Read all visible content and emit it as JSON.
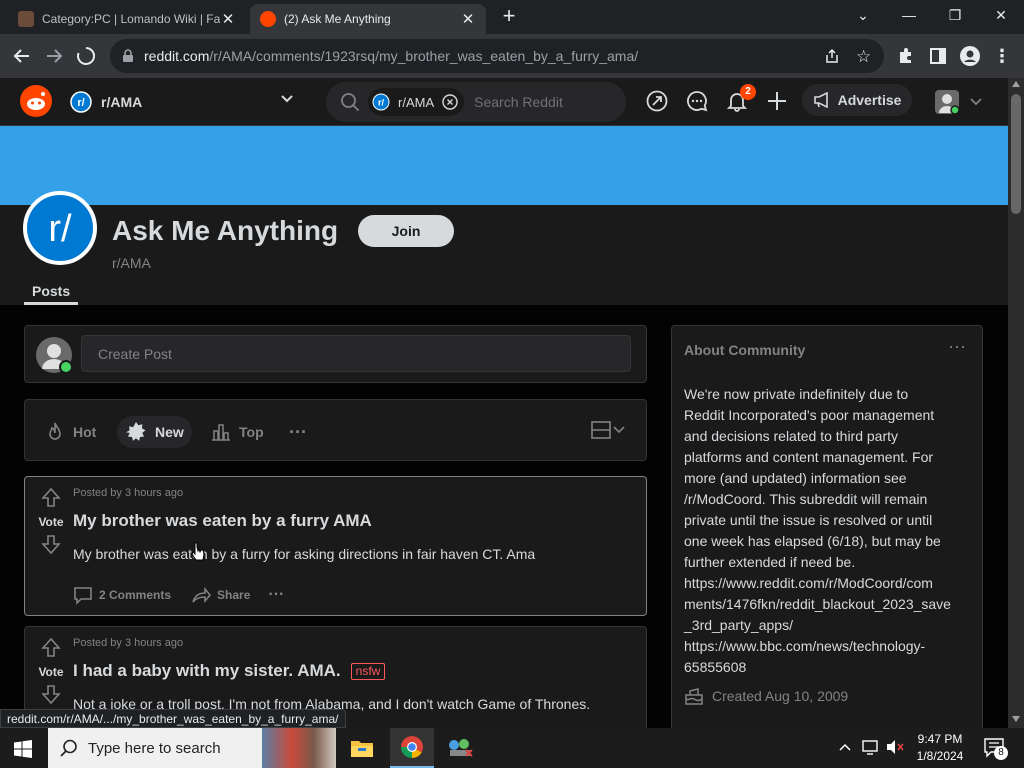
{
  "browser": {
    "tabs": [
      {
        "title": "Category:PC | Lomando Wiki | Fa",
        "active": false
      },
      {
        "title": "(2) Ask Me Anything",
        "active": true
      }
    ],
    "url_host": "reddit.com",
    "url_path": "/r/AMA/comments/1923rsq/my_brother_was_eaten_by_a_furry_ama/",
    "status_url": "reddit.com/r/AMA/.../my_brother_was_eaten_by_a_furry_ama/"
  },
  "reddit_header": {
    "community": "r/AMA",
    "search_chip": "r/AMA",
    "search_placeholder": "Search Reddit",
    "notification_count": "2",
    "advertise_label": "Advertise"
  },
  "community": {
    "name": "Ask Me Anything",
    "handle": "r/AMA",
    "join_label": "Join",
    "tab_posts": "Posts",
    "banner_color": "#33a0e8"
  },
  "create_post": {
    "placeholder": "Create Post"
  },
  "sort": {
    "hot": "Hot",
    "new": "New",
    "top": "Top"
  },
  "posts": [
    {
      "meta": "Posted by 3 hours ago",
      "vote_label": "Vote",
      "title": "My brother was eaten by a furry AMA",
      "body": "My brother was eaten by a furry for asking directions in fair haven CT. Ama",
      "comments": "2 Comments",
      "share": "Share"
    },
    {
      "meta": "Posted by 3 hours ago",
      "vote_label": "Vote",
      "title": "I had a baby with my sister. AMA.",
      "flair": "nsfw",
      "body": "Not a joke or a troll post. I'm not from Alabama, and I don't watch Game of Thrones."
    }
  ],
  "about": {
    "heading": "About Community",
    "lines": [
      "We're now private indefinitely due to",
      "Reddit Incorporated's poor management",
      "and decisions related to third party",
      "platforms and content management. For",
      "more (and updated) information see",
      "/r/ModCoord. This subreddit will remain",
      "private until the issue is resolved or until",
      "one week has elapsed (6/18), but may be",
      "further extended if need be.",
      "https://www.reddit.com/r/ModCoord/com",
      "ments/1476fkn/reddit_blackout_2023_save",
      "_3rd_party_apps/",
      "https://www.bbc.com/news/technology-",
      "65855608"
    ],
    "created": "Created Aug 10, 2009"
  },
  "taskbar": {
    "search_placeholder": "Type here to search",
    "time": "9:47 PM",
    "date": "1/8/2024",
    "notification_count": "8"
  }
}
